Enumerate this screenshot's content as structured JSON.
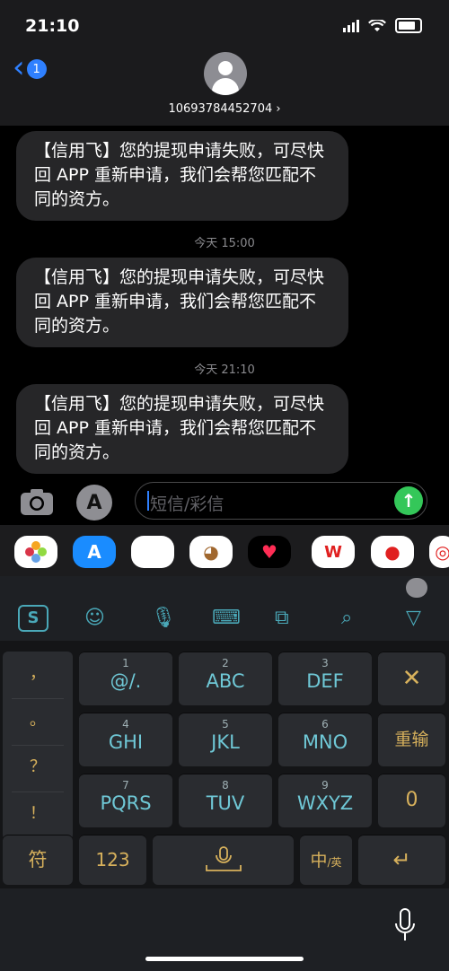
{
  "status_bar": {
    "time": "21:10"
  },
  "header": {
    "back_badge": "1",
    "contact": "10693784452704 ›"
  },
  "messages": [
    {
      "text": "【信用飞】您的提现申请失败，可尽快回 APP 重新申请，我们会帮您匹配不同的资方。"
    },
    {
      "timestamp": "今天 15:00",
      "text": "【信用飞】您的提现申请失败，可尽快回 APP 重新申请，我们会帮您匹配不同的资方。"
    },
    {
      "timestamp": "今天 21:10",
      "text": "【信用飞】您的提现申请失败，可尽快回 APP 重新申请，我们会帮您匹配不同的资方。"
    }
  ],
  "input": {
    "placeholder": "短信/彩信"
  },
  "keyboard": {
    "left_column": [
      "，",
      "。",
      "？",
      "！"
    ],
    "rows": [
      [
        {
          "num": "1",
          "label": "@/."
        },
        {
          "num": "2",
          "label": "ABC"
        },
        {
          "num": "3",
          "label": "DEF"
        }
      ],
      [
        {
          "num": "4",
          "label": "GHI"
        },
        {
          "num": "5",
          "label": "JKL"
        },
        {
          "num": "6",
          "label": "MNO"
        }
      ],
      [
        {
          "num": "7",
          "label": "PQRS"
        },
        {
          "num": "8",
          "label": "TUV"
        },
        {
          "num": "9",
          "label": "WXYZ"
        }
      ]
    ],
    "delete_label": "✕",
    "retype_label": "重输",
    "zero_label": "0",
    "symbol_label": "符",
    "num_label": "123",
    "lang_main": "中",
    "lang_sub": "/英"
  },
  "colors": {
    "accent": "#2f80ff",
    "bubble": "#262628",
    "send": "#34c759",
    "key_text": "#6fc8d6",
    "gold": "#d7b15c"
  }
}
